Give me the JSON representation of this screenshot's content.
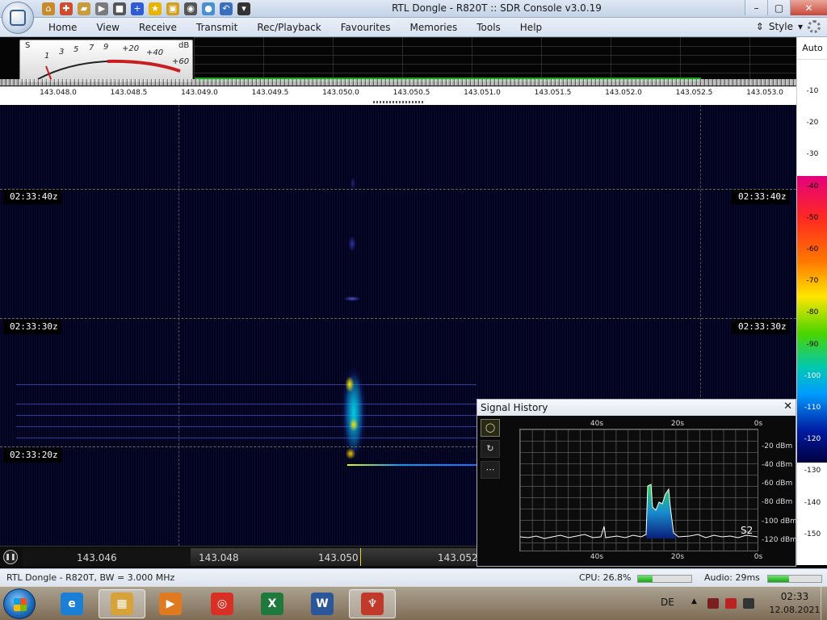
{
  "window": {
    "title": "RTL Dongle - R820T :: SDR Console v3.0.19",
    "minimize": "–",
    "maximize": "▢",
    "close": "✕"
  },
  "ribbon": {
    "tabs": [
      "Home",
      "View",
      "Receive",
      "Transmit",
      "Rec/Playback",
      "Favourites",
      "Memories",
      "Tools",
      "Help"
    ],
    "style_label": "Style"
  },
  "quick_access": [
    {
      "icon": "home-icon",
      "glyph": "⌂",
      "color": "#c98a2c"
    },
    {
      "icon": "lifebuoy-icon",
      "glyph": "✚",
      "color": "#d24b2a"
    },
    {
      "icon": "folder-icon",
      "glyph": "▰",
      "color": "#c99b3a"
    },
    {
      "icon": "play-icon",
      "glyph": "▶",
      "color": "#7a7a7a"
    },
    {
      "icon": "stop-icon",
      "glyph": "■",
      "color": "#555555"
    },
    {
      "icon": "add-icon",
      "glyph": "+",
      "color": "#2f5bd3"
    },
    {
      "icon": "star-icon",
      "glyph": "★",
      "color": "#e8b400"
    },
    {
      "icon": "lock-icon",
      "glyph": "▣",
      "color": "#d0a020"
    },
    {
      "icon": "camera-icon",
      "glyph": "◉",
      "color": "#555555"
    },
    {
      "icon": "drop-icon",
      "glyph": "●",
      "color": "#4a8fd0"
    },
    {
      "icon": "undo-icon",
      "glyph": "↶",
      "color": "#3a6fc0"
    },
    {
      "icon": "dropdown-icon",
      "glyph": "▾",
      "color": "#333333"
    }
  ],
  "smeter": {
    "s_label": "S",
    "db_label": "dB",
    "scale": [
      "1",
      "3",
      "5",
      "7",
      "9",
      "+20",
      "+40",
      "+60"
    ]
  },
  "frequency_ruler": [
    "143.048.0",
    "143.048.5",
    "143.049.0",
    "143.049.5",
    "143.050.0",
    "143.050.5",
    "143.051.0",
    "143.051.5",
    "143.052.0",
    "143.052.5",
    "143.053.0"
  ],
  "waterfall": {
    "timestamps": [
      {
        "time": "02:33:40z"
      },
      {
        "time": "02:33:30z"
      },
      {
        "time": "02:33:20z"
      }
    ]
  },
  "db_scale": {
    "auto_label": "Auto",
    "labels": [
      "-10",
      "-20",
      "-30",
      "-40",
      "-50",
      "-60",
      "-70",
      "-80",
      "-90",
      "-100",
      "-110",
      "-120",
      "-130",
      "-140",
      "-150"
    ]
  },
  "bottom_bar": {
    "labels": [
      "143.046",
      "143.048",
      "143.050",
      "143.052"
    ]
  },
  "signal_history": {
    "title": "Signal History",
    "close": "✕",
    "time_axis": [
      "40s",
      "20s",
      "0s"
    ],
    "y_axis": [
      "-20 dBm",
      "-40 dBm",
      "-60 dBm",
      "-80 dBm",
      "-100 dBm",
      "-120 dBm"
    ],
    "s_readout": "S2",
    "tools": [
      "◯",
      "↻",
      "⋯"
    ]
  },
  "status": {
    "left": "RTL Dongle - R820T, BW = 3.000 MHz",
    "cpu": "CPU: 26.8%",
    "cpu_level": 0.268,
    "audio": "Audio: 29ms",
    "audio_level": 0.8
  },
  "taskbar": {
    "apps": [
      {
        "name": "ie-icon",
        "glyph": "e",
        "color": "#1b7fd6"
      },
      {
        "name": "explorer-icon",
        "glyph": "▦",
        "color": "#d8a23a"
      },
      {
        "name": "media-player-icon",
        "glyph": "▶",
        "color": "#e07a20"
      },
      {
        "name": "chrome-icon",
        "glyph": "◎",
        "color": "#d93025"
      },
      {
        "name": "excel-icon",
        "glyph": "X",
        "color": "#1e7a3c"
      },
      {
        "name": "word-icon",
        "glyph": "W",
        "color": "#2b579a"
      },
      {
        "name": "sdr-console-icon",
        "glyph": "♆",
        "color": "#c0392b"
      }
    ],
    "language": "DE",
    "time": "02:33",
    "date": "12.08.2021"
  }
}
